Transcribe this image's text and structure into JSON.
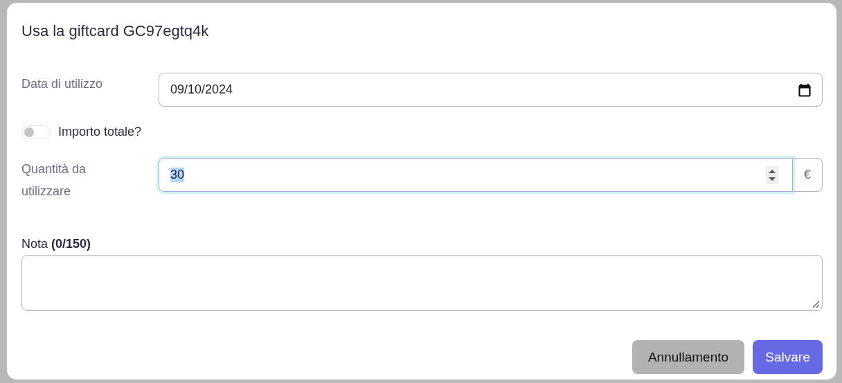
{
  "dialog": {
    "title": "Usa la giftcard GC97egtq4k"
  },
  "fields": [
    {
      "kind": "date",
      "label": "Data di utilizzo",
      "value": "09/10/2024"
    },
    {
      "kind": "toggle",
      "label": "Importo totale?",
      "on": false
    },
    {
      "kind": "number",
      "label": "Quantità da utilizzare",
      "value": "30",
      "addon": "€",
      "focused": true
    }
  ],
  "note": {
    "label": "Nota **(0/150)**"
  },
  "buttons": [
    {
      "kind": "secondary",
      "label": "Annullamento"
    },
    {
      "kind": "primary",
      "label": "Salvare"
    }
  ]
}
